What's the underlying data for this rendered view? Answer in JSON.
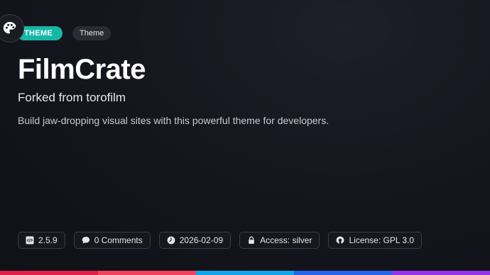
{
  "tags": {
    "primary": "THEME",
    "secondary": "Theme"
  },
  "title": "FilmCrate",
  "subtitle": "Forked from torofilm",
  "description": "Build jaw-dropping visual sites with this powerful theme for developers.",
  "meta": [
    {
      "icon": "code-file-icon",
      "label": "2.5.9"
    },
    {
      "icon": "comment-icon",
      "label": "0 Comments"
    },
    {
      "icon": "clock-icon",
      "label": "2026-02-09"
    },
    {
      "icon": "lock-icon",
      "label": "Access: silver"
    },
    {
      "icon": "open-source-icon",
      "label": "License: GPL 3.0"
    }
  ],
  "colors": {
    "accent": "#14b8a6",
    "bottom_bar": [
      "#e11d48",
      "#f43f5e",
      "#0ea5e9",
      "#2563eb",
      "#9333ea"
    ]
  }
}
